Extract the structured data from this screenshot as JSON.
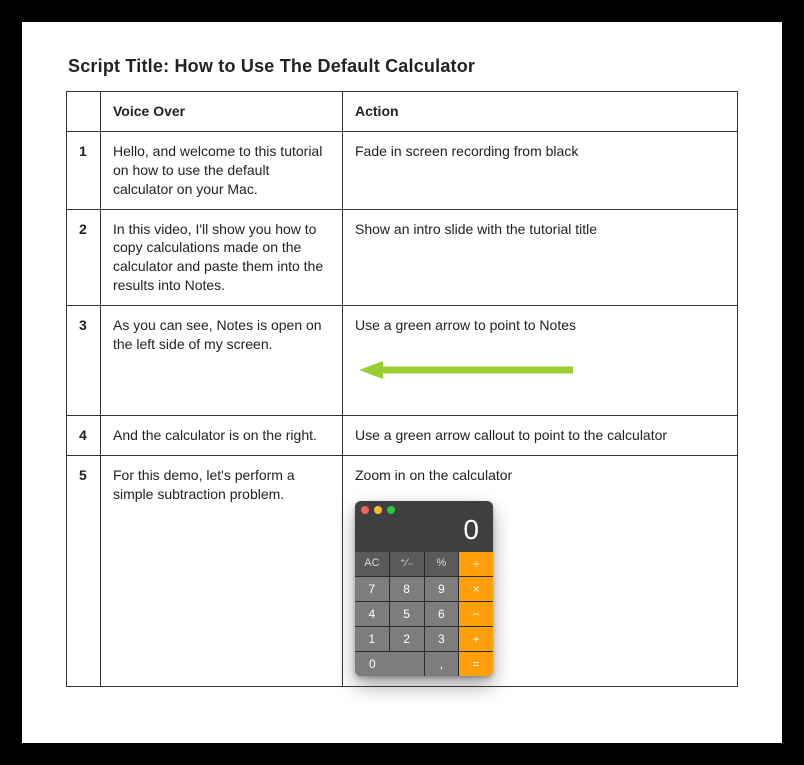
{
  "title": "Script Title: How to Use The Default Calculator",
  "headers": {
    "num": "",
    "voice": "Voice Over",
    "action": "Action"
  },
  "rows": [
    {
      "n": "1",
      "voice": "Hello, and welcome to this tutorial on how to use the default calculator on your Mac.",
      "action": "Fade in screen recording from black"
    },
    {
      "n": "2",
      "voice": "In this video, I'll show you how to copy calculations made on the calculator and paste them into the results into Notes.",
      "action": "Show an intro slide with the tutorial title"
    },
    {
      "n": "3",
      "voice": "As you can see, Notes is open on the left side of my screen.",
      "action": "Use a green arrow to point to Notes"
    },
    {
      "n": "4",
      "voice": "And the calculator is on the right.",
      "action": "Use a green arrow callout to point to the calculator"
    },
    {
      "n": "5",
      "voice": "For this demo, let's perform a simple subtraction problem.",
      "action": "Zoom in on the calculator"
    }
  ],
  "calculator": {
    "display": "0",
    "keys_row1": [
      "AC",
      "⁺∕₋",
      "%",
      "÷"
    ],
    "keys_row2": [
      "7",
      "8",
      "9",
      "×"
    ],
    "keys_row3": [
      "4",
      "5",
      "6",
      "−"
    ],
    "keys_row4": [
      "1",
      "2",
      "3",
      "+"
    ],
    "keys_row5": [
      "0",
      ",",
      "="
    ]
  }
}
